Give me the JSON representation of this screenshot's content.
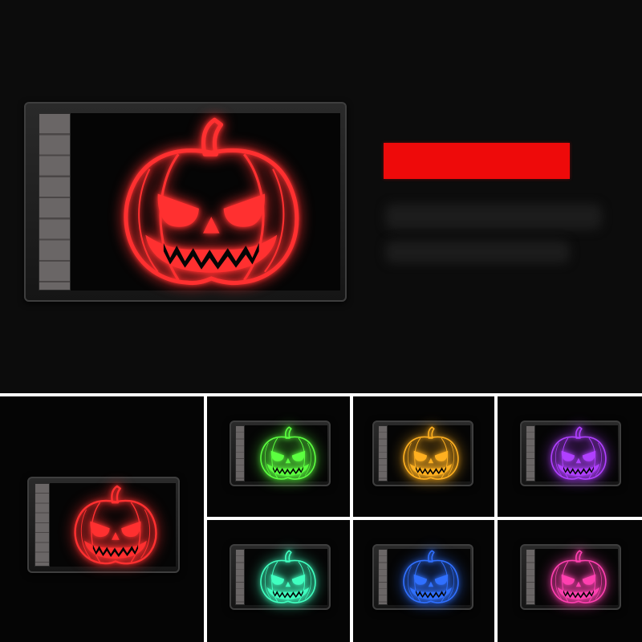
{
  "variants": [
    {
      "color_name": "red",
      "color": "#ff3030"
    },
    {
      "color_name": "green",
      "color": "#5cff40"
    },
    {
      "color_name": "orange",
      "color": "#ffb020"
    },
    {
      "color_name": "purple",
      "color": "#b040ff"
    },
    {
      "color_name": "red",
      "color": "#ff3030"
    },
    {
      "color_name": "cyan",
      "color": "#40ffc0"
    },
    {
      "color_name": "blue",
      "color": "#3070ff"
    },
    {
      "color_name": "pink",
      "color": "#ff40b0"
    }
  ],
  "banner_color": "#ee0a0a",
  "icons": [
    "pumpkin-lamp-icon"
  ]
}
